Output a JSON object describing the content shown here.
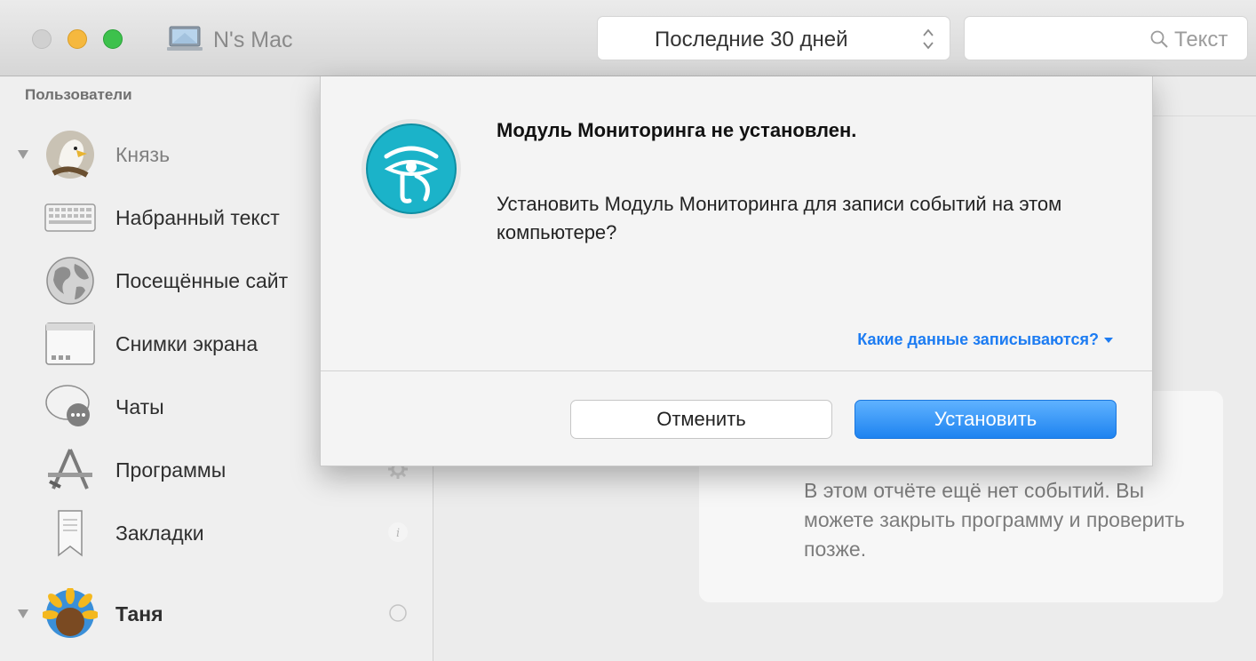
{
  "window": {
    "computer_name": "N's Mac"
  },
  "toolbar": {
    "period": "Последние 30 дней",
    "search_placeholder": "Текст"
  },
  "sidebar": {
    "header": "Пользователи",
    "users": [
      {
        "name": "Князь",
        "items": [
          {
            "label": "Набранный текст",
            "icon": "keyboard-icon"
          },
          {
            "label": "Посещённые сайт",
            "icon": "globe-icon"
          },
          {
            "label": "Снимки экрана",
            "icon": "screenshot-window-icon"
          },
          {
            "label": "Чаты",
            "icon": "chat-bubble-icon"
          },
          {
            "label": "Программы",
            "icon": "app-store-icon"
          },
          {
            "label": "Закладки",
            "icon": "bookmark-icon"
          }
        ]
      },
      {
        "name": "Таня"
      }
    ]
  },
  "main": {
    "empty_message": "В этом отчёте ещё нет событий. Вы можете закрыть программу и проверить позже."
  },
  "dialog": {
    "title": "Модуль Мониторинга не установлен.",
    "message": "Установить Модуль Мониторинга для записи событий на этом компьютере?",
    "link": "Какие данные записываются?",
    "cancel_label": "Отменить",
    "install_label": "Установить"
  },
  "colors": {
    "accent": "#1d7cf2",
    "icon_teal": "#1bb3c9",
    "traffic_min": "#f5b83e",
    "traffic_max": "#3dc14c"
  }
}
